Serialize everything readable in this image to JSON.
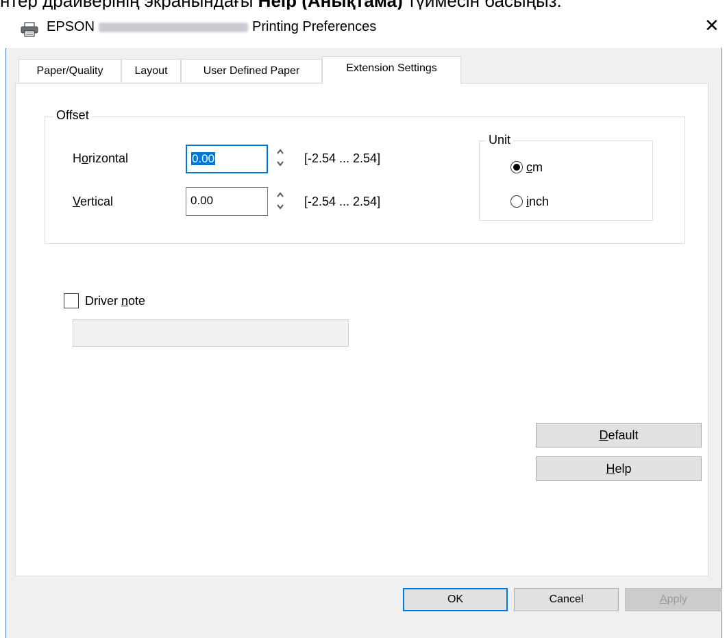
{
  "caption": {
    "prefix": "нтер драйверінің экранындағы ",
    "bold": "Help (Анықтама)",
    "suffix": " түймесін басыңыз."
  },
  "window": {
    "title_prefix": "EPSON",
    "title_suffix": "Printing Preferences",
    "icon": "printer-icon",
    "close_glyph": "✕"
  },
  "tabs": [
    {
      "label": "Paper/Quality",
      "active": false
    },
    {
      "label": "Layout",
      "active": false
    },
    {
      "label": "User Defined Paper",
      "active": false
    },
    {
      "label": "Extension Settings",
      "active": true
    }
  ],
  "offset": {
    "label": "Offset",
    "horizontal": {
      "label_pre": "H",
      "label_u": "o",
      "label_post": "rizontal",
      "value": "0.00",
      "range": "[-2.54 ... 2.54]"
    },
    "vertical": {
      "label_pre": "",
      "label_u": "V",
      "label_post": "ertical",
      "value": "0.00",
      "range": "[-2.54 ... 2.54]"
    }
  },
  "unit": {
    "label": "Unit",
    "options": [
      {
        "label_u": "c",
        "label_post": "m",
        "checked": true
      },
      {
        "label_u": "i",
        "label_post": "nch",
        "checked": false
      }
    ]
  },
  "driver_note": {
    "label_pre": "Driver ",
    "label_u": "n",
    "label_post": "ote",
    "checked": false,
    "value": ""
  },
  "buttons": {
    "default": {
      "label_u": "D",
      "label_post": "efault"
    },
    "help": {
      "label_u": "H",
      "label_post": "elp"
    },
    "ok": "OK",
    "cancel": "Cancel",
    "apply": {
      "label_u": "A",
      "label_post": "pply"
    }
  }
}
